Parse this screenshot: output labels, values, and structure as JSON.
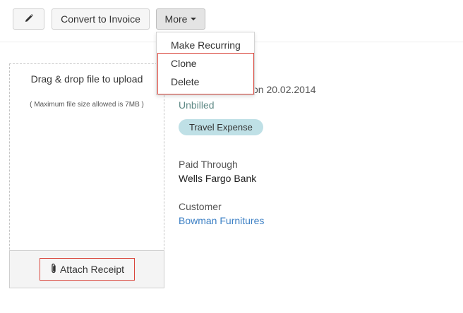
{
  "toolbar": {
    "edit_icon": "pencil-icon",
    "convert_label": "Convert to Invoice",
    "more_label": "More"
  },
  "more_menu": {
    "items": [
      {
        "label": "Make Recurring"
      },
      {
        "label": "Clone"
      },
      {
        "label": "Delete"
      }
    ],
    "highlight_color": "#d9453b"
  },
  "upload": {
    "title": "Drag & drop file to upload",
    "note": "( Maximum file size allowed is 7MB )",
    "attach_label": "Attach Receipt",
    "attach_icon": "paperclip-icon"
  },
  "expense": {
    "date_text": "on 20.02.2014",
    "status": "Unbilled",
    "category": "Travel Expense",
    "paid_through_label": "Paid Through",
    "paid_through_value": "Wells Fargo Bank",
    "customer_label": "Customer",
    "customer_value": "Bowman Furnitures"
  },
  "colors": {
    "status": "#5f8a86",
    "badge_bg": "#bfe0e6",
    "link": "#3b7fc4"
  }
}
